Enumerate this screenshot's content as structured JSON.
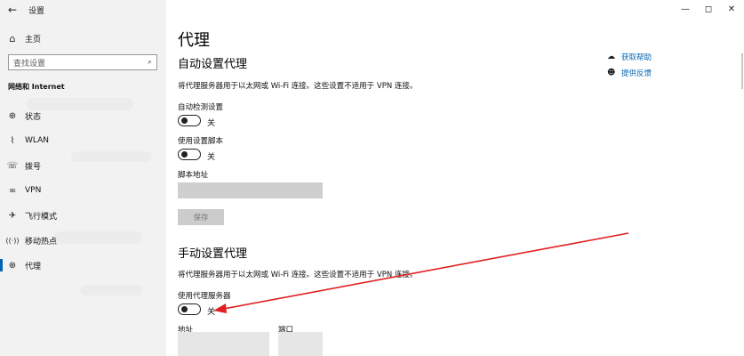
{
  "window": {
    "title": "设置",
    "back_icon": "←",
    "minimize_icon": "—",
    "maximize_icon": "◻",
    "close_icon": "✕"
  },
  "nav": {
    "home_icon": "⌂",
    "home": "主页",
    "search_placeholder": "查找设置",
    "search_icon": "⌕",
    "section": "网络和 Internet",
    "items": [
      {
        "icon": "⊕",
        "label": "状态"
      },
      {
        "icon": "⌇",
        "label": "WLAN"
      },
      {
        "icon": "☏",
        "label": "拨号"
      },
      {
        "icon": "∞",
        "label": "VPN"
      },
      {
        "icon": "✈",
        "label": "飞行模式"
      },
      {
        "icon": "((·))",
        "label": "移动热点"
      },
      {
        "icon": "⊕",
        "label": "代理"
      }
    ]
  },
  "main": {
    "title": "代理",
    "auto": {
      "heading": "自动设置代理",
      "desc": "将代理服务器用于以太网或 Wi-Fi 连接。这些设置不适用于 VPN 连接。",
      "detect_label": "自动检测设置",
      "detect_state": "关",
      "script_label": "使用设置脚本",
      "script_state": "关",
      "address_label": "脚本地址",
      "save": "保存"
    },
    "manual": {
      "heading": "手动设置代理",
      "desc": "将代理服务器用于以太网或 Wi-Fi 连接。这些设置不适用于 VPN 连接。",
      "use_proxy_label": "使用代理服务器",
      "use_proxy_state": "关",
      "address_label": "地址",
      "port_label": "端口"
    },
    "help": {
      "get_help": "获取帮助",
      "feedback": "提供反馈"
    }
  },
  "colors": {
    "accent": "#0063b1",
    "link": "#0066b4",
    "annotation": "#e02020"
  }
}
